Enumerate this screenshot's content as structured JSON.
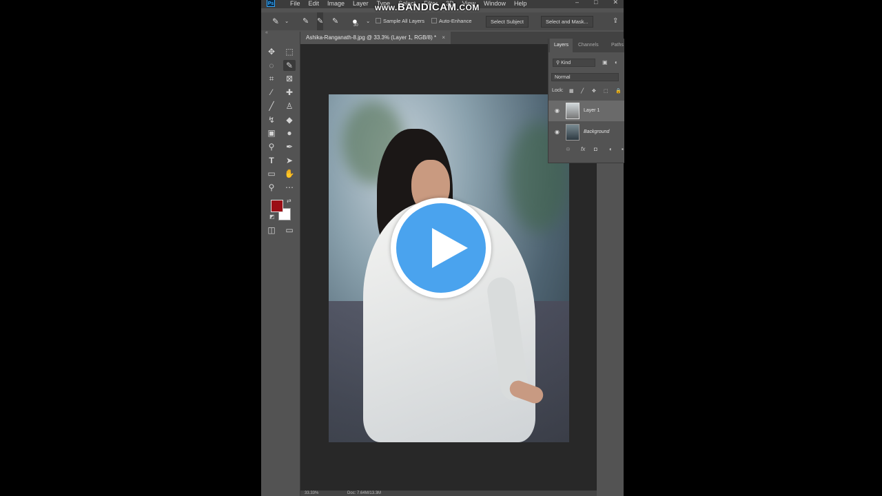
{
  "app": {
    "logo": "Ps"
  },
  "menu": [
    "File",
    "Edit",
    "Image",
    "Layer",
    "Type",
    "Select",
    "Filter",
    "3D",
    "View",
    "Window",
    "Help"
  ],
  "watermark": {
    "prefix": "www.",
    "brand": "BANDICAM",
    "suffix": ".COM"
  },
  "options_bar": {
    "brush_size": "30",
    "sample_all_layers": "Sample All Layers",
    "auto_enhance": "Auto-Enhance",
    "select_subject": "Select Subject",
    "select_and_mask": "Select and Mask..."
  },
  "document_tab": {
    "title": "Ashika-Ranganath-8.jpg @ 33.3% (Layer 1, RGB/8) *",
    "close": "×"
  },
  "colors": {
    "foreground": "#9b0d15",
    "background": "#ffffff",
    "play_button": "#4aa3ee"
  },
  "layers_panel": {
    "tabs": [
      "Layers",
      "Channels",
      "Paths"
    ],
    "filter_kind": "Kind",
    "blend_mode": "Normal",
    "lock_label": "Lock:",
    "layers": [
      {
        "name": "Layer 1",
        "selected": true,
        "visible": true
      },
      {
        "name": "Background",
        "selected": false,
        "visible": true
      }
    ],
    "footer_fx": "fx"
  },
  "status_bar": {
    "zoom": "33.33%",
    "doc": "Doc: 7.64M/13.3M"
  },
  "tools": [
    "move-icon",
    "marquee-icon",
    "lasso-icon",
    "quick-selection-icon",
    "crop-icon",
    "frame-icon",
    "eyedropper-icon",
    "healing-icon",
    "brush-icon",
    "stamp-icon",
    "history-brush-icon",
    "eraser-icon",
    "gradient-icon",
    "blur-icon",
    "dodge-icon",
    "pen-icon",
    "type-icon",
    "path-select-icon",
    "rectangle-icon",
    "hand-icon",
    "zoom-icon",
    "more-icon"
  ]
}
